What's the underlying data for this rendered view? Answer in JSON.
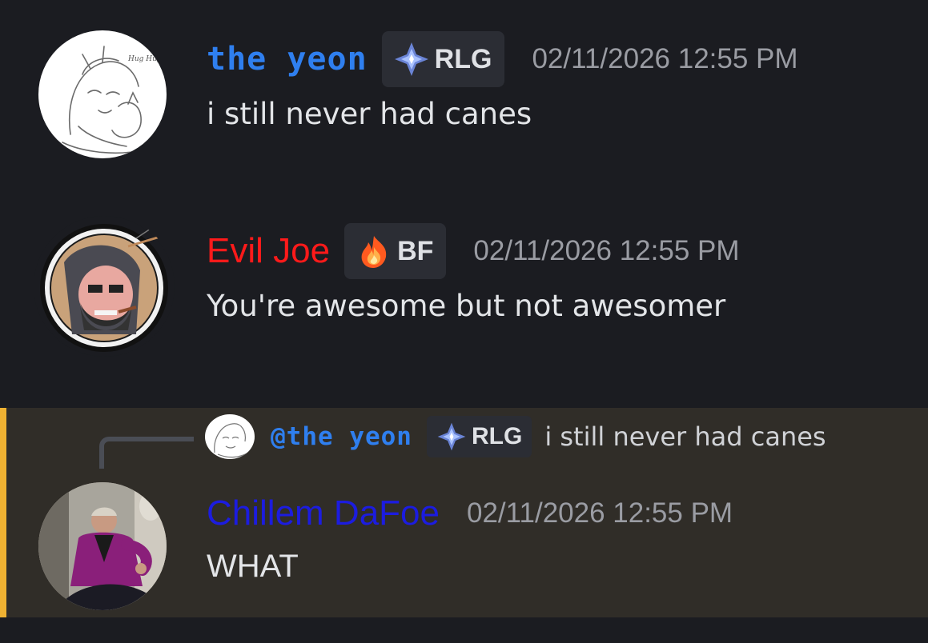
{
  "messages": [
    {
      "username": "the yeon",
      "username_color": "#2f7fef",
      "tag": {
        "label": "RLG",
        "icon": "diamond-star-icon"
      },
      "timestamp": "02/11/2026 12:55 PM",
      "content": "i still never had canes",
      "avatar_text": "Hug Hug!!"
    },
    {
      "username": "Evil Joe",
      "username_color": "#ff1a1a",
      "tag": {
        "label": "BF",
        "icon": "flame-icon"
      },
      "timestamp": "02/11/2026 12:55 PM",
      "content": "You're awesome but not awesomer"
    },
    {
      "username": "Chillem DaFoe",
      "username_color": "#1c1ce0",
      "timestamp": "02/11/2026 12:55 PM",
      "content": "WHAT",
      "reply": {
        "mention": "@the yeon",
        "tag": {
          "label": "RLG",
          "icon": "diamond-star-icon"
        },
        "content": "i still never had canes"
      }
    }
  ],
  "colors": {
    "background": "#1b1c21",
    "highlight_background": "#302d28",
    "highlight_bar": "#f0b232",
    "timestamp": "#9a9ca3",
    "tag_background": "#2b2d34"
  }
}
